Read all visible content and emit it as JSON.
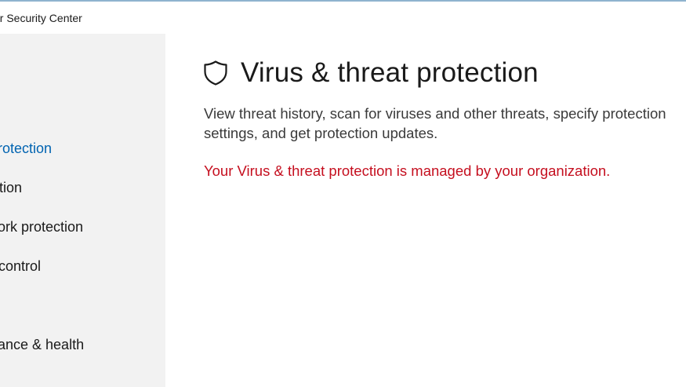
{
  "window": {
    "title": "er Security Center"
  },
  "sidebar": {
    "items": [
      {
        "label": "rotection",
        "active": true
      },
      {
        "label": "tion",
        "active": false
      },
      {
        "label": "ork protection",
        "active": false
      },
      {
        "label": " control",
        "active": false
      },
      {
        "label": "ance & health",
        "active": false
      }
    ]
  },
  "main": {
    "icon": "shield-icon",
    "title": "Virus & threat protection",
    "description": "View threat history, scan for viruses and other threats, specify protection settings, and get protection updates.",
    "managed_notice": "Your Virus & threat protection is managed by your organization."
  },
  "colors": {
    "accent": "#0063b1",
    "warning": "#c50f1f",
    "sidebar_bg": "#f2f2f2"
  }
}
